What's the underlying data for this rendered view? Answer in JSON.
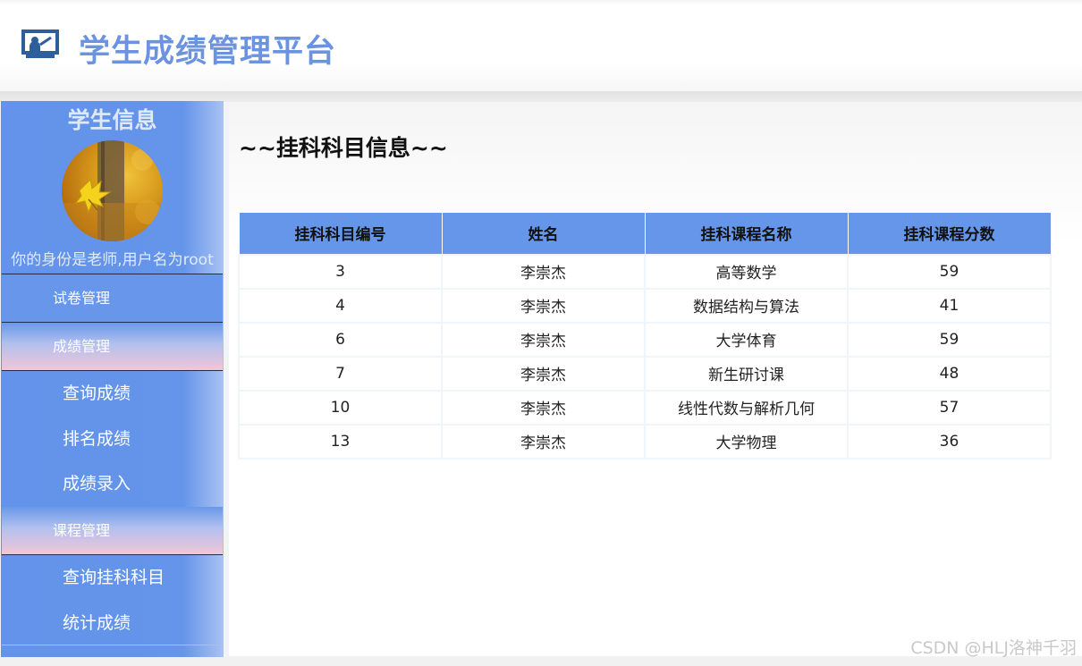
{
  "header": {
    "title": "学生成绩管理平台",
    "icon": "presentation-board-icon",
    "accent_color": "#6b93e0"
  },
  "sidebar": {
    "title": "学生信息",
    "avatar": "autumn-leaf-avatar",
    "identity_text": "你的身份是老师,用户名为root",
    "menu": [
      {
        "label": "试卷管理",
        "style": "blue",
        "items": []
      },
      {
        "label": "成绩管理",
        "style": "pink",
        "items": [
          "查询成绩",
          "排名成绩",
          "成绩录入"
        ]
      },
      {
        "label": "课程管理",
        "style": "pink",
        "items": [
          "查询挂科科目",
          "统计成绩"
        ]
      }
    ],
    "colors": {
      "background": "#6393ea",
      "pink_gradient_end": "#f1c6d7"
    }
  },
  "main": {
    "heading": "~~挂科科目信息~~",
    "table": {
      "columns": [
        "挂科科目编号",
        "姓名",
        "挂科课程名称",
        "挂科课程分数"
      ],
      "rows": [
        [
          "3",
          "李崇杰",
          "高等数学",
          "59"
        ],
        [
          "4",
          "李崇杰",
          "数据结构与算法",
          "41"
        ],
        [
          "6",
          "李崇杰",
          "大学体育",
          "59"
        ],
        [
          "7",
          "李崇杰",
          "新生研讨课",
          "48"
        ],
        [
          "10",
          "李崇杰",
          "线性代数与解析几何",
          "57"
        ],
        [
          "13",
          "李崇杰",
          "大学物理",
          "36"
        ]
      ],
      "header_color": "#6596ea"
    }
  },
  "watermark": "CSDN @HLJ洛神千羽"
}
